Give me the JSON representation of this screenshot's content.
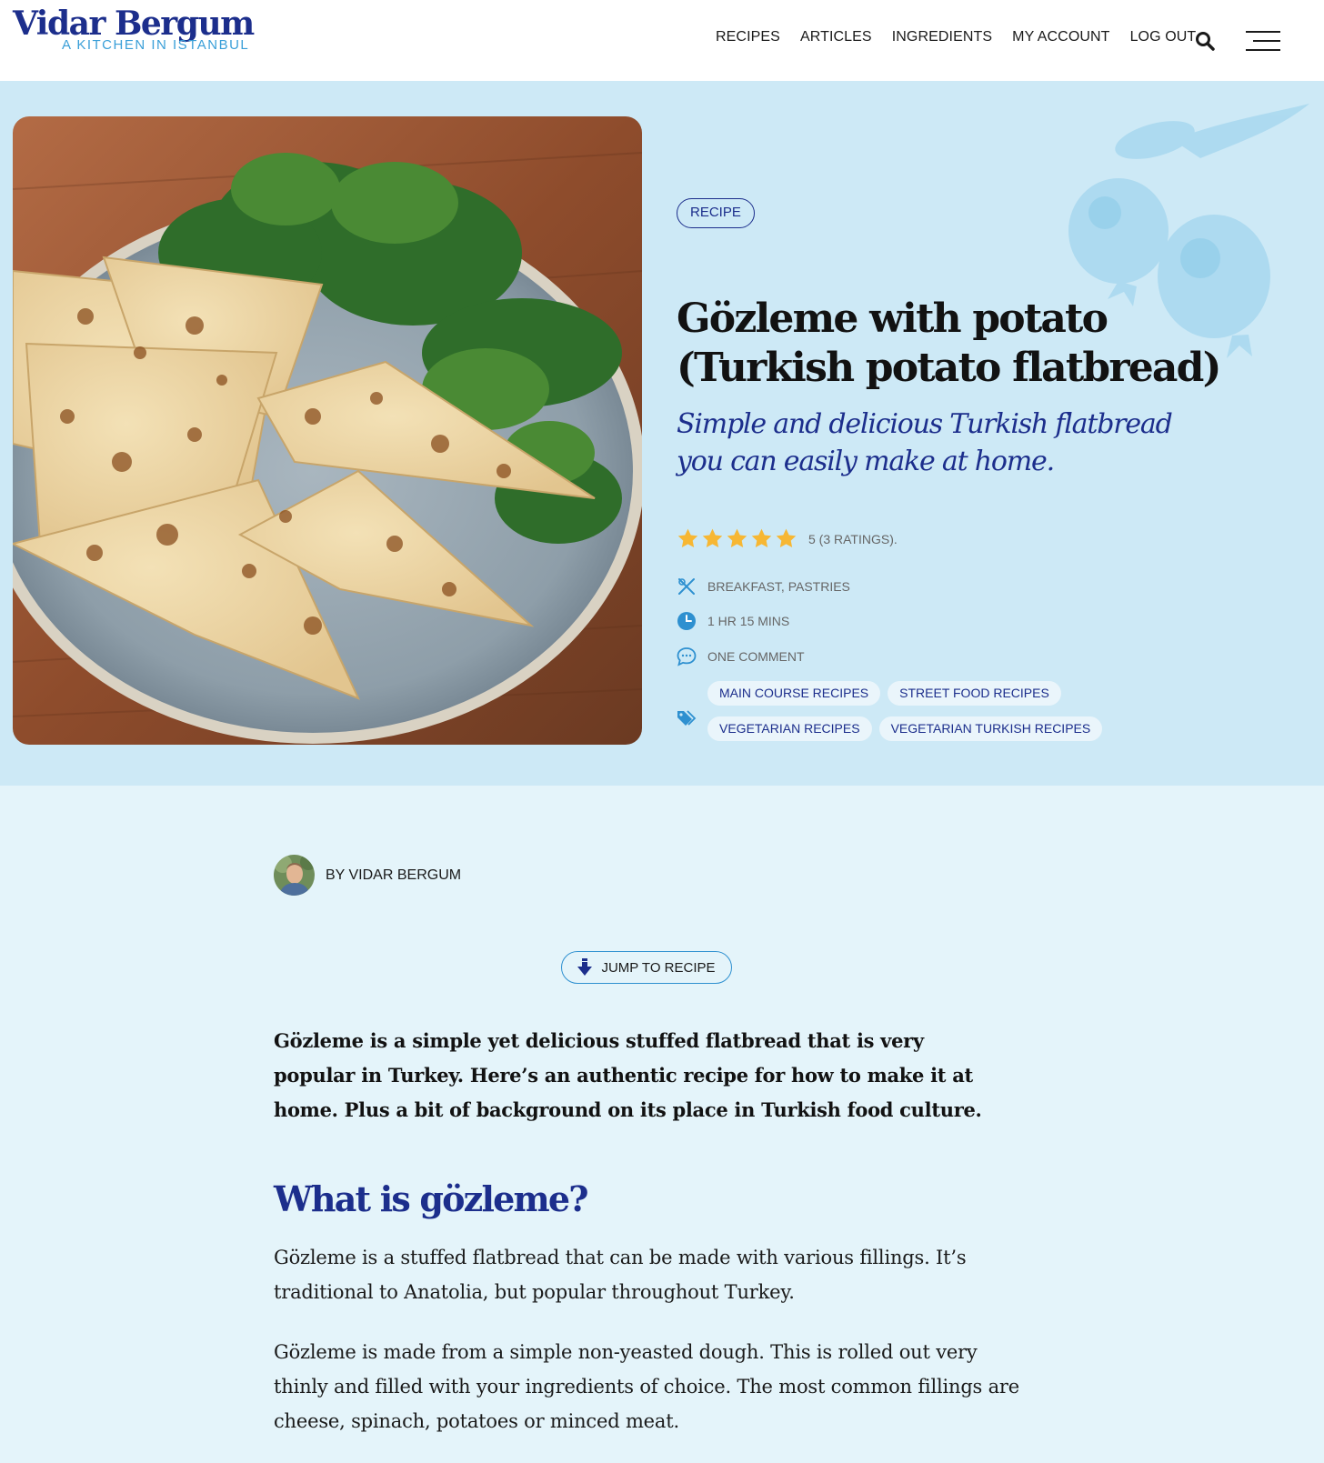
{
  "header": {
    "logo_name": "Vidar Bergum",
    "logo_tagline": "A KITCHEN IN ISTANBUL",
    "nav": [
      "RECIPES",
      "ARTICLES",
      "INGREDIENTS",
      "MY ACCOUNT",
      "LOG OUT"
    ],
    "icons": [
      "search-icon",
      "menu-icon"
    ]
  },
  "hero": {
    "pill_label": "RECIPE",
    "title": "Gözleme with potato (Turkish potato flatbread)",
    "subtitle": "Simple and delicious Turkish flatbread you can easily make at home.",
    "rating": {
      "stars": 5,
      "text": "5 (3 RATINGS)."
    },
    "meta": {
      "category": "BREAKFAST, PASTRIES",
      "time": "1 HR 15  MINS",
      "comments": "ONE COMMENT"
    },
    "tags": [
      "MAIN COURSE RECIPES",
      "STREET FOOD RECIPES",
      "VEGETARIAN RECIPES",
      "VEGETARIAN TURKISH RECIPES"
    ]
  },
  "article": {
    "byline": "BY VIDAR BERGUM",
    "jump_label": "JUMP TO RECIPE",
    "lead": "Gözleme is a simple yet delicious stuffed flatbread that is very popular in Turkey. Here’s an authentic recipe for how to make it at home. Plus a bit of background on its place in Turkish food culture.",
    "heading": "What is gözleme?",
    "paragraphs": [
      "Gözleme is a stuffed flatbread that can be made with various fillings. It’s traditional to Anatolia, but popular throughout Turkey.",
      "Gözleme is made from a simple non-yeasted dough. This is rolled out very thinly and filled with your ingredients of choice. The most common fillings are cheese, spinach, potatoes or minced meat."
    ]
  },
  "colors": {
    "brand_navy": "#1c2e8c",
    "accent_blue": "#2e90d0",
    "hero_bg": "#cde9f6",
    "page_bg": "#e4f4fa",
    "star": "#f7b733"
  }
}
